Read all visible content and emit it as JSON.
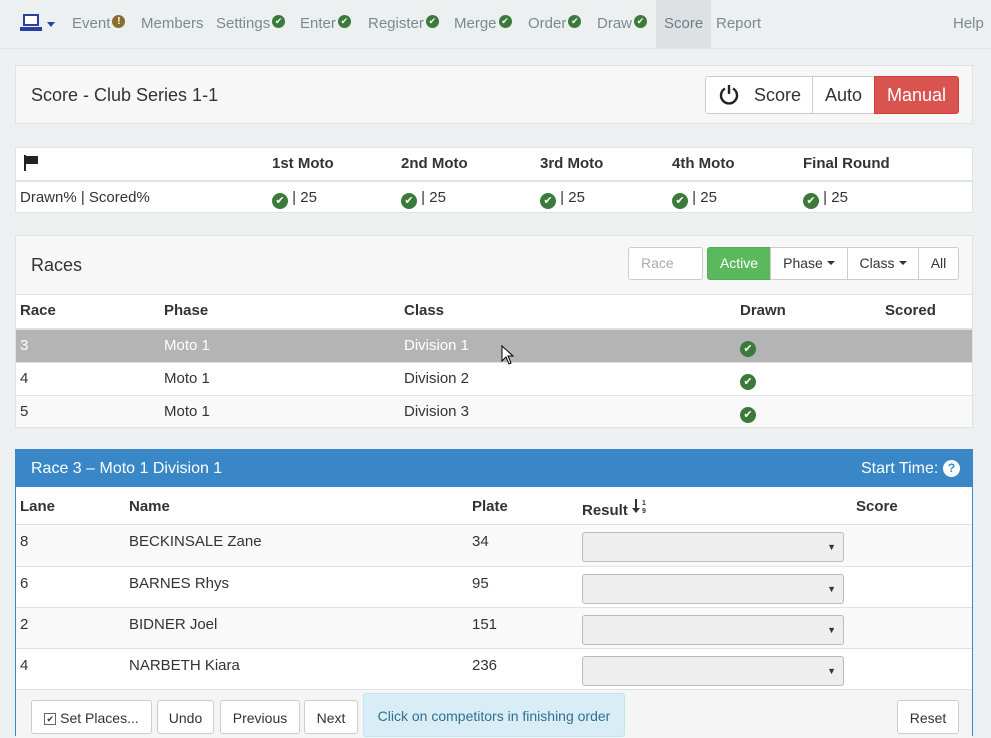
{
  "nav": {
    "items": [
      {
        "label": "Event",
        "status": "warn"
      },
      {
        "label": "Members",
        "status": "none"
      },
      {
        "label": "Settings",
        "status": "ok"
      },
      {
        "label": "Enter",
        "status": "ok"
      },
      {
        "label": "Register",
        "status": "ok"
      },
      {
        "label": "Merge",
        "status": "ok"
      },
      {
        "label": "Order",
        "status": "ok"
      },
      {
        "label": "Draw",
        "status": "ok"
      },
      {
        "label": "Score",
        "status": "active"
      },
      {
        "label": "Report",
        "status": "none"
      }
    ],
    "help": "Help",
    "warn_glyph": "!",
    "ok_glyph": "✔"
  },
  "score_header": {
    "title": "Score - Club Series 1-1",
    "score_label": "Score",
    "auto_label": "Auto",
    "manual_label": "Manual"
  },
  "summary": {
    "columns": [
      "1st Moto",
      "2nd Moto",
      "3rd Moto",
      "4th Moto",
      "Final Round"
    ],
    "row_label": "Drawn% | Scored%",
    "values": [
      "| 25",
      "| 25",
      "| 25",
      "| 25",
      "| 25"
    ]
  },
  "races": {
    "title": "Races",
    "race_placeholder": "Race",
    "active_label": "Active",
    "phase_label": "Phase",
    "class_label": "Class",
    "all_label": "All",
    "headers": {
      "race": "Race",
      "phase": "Phase",
      "class": "Class",
      "drawn": "Drawn",
      "scored": "Scored"
    },
    "rows": [
      {
        "race": "3",
        "phase": "Moto 1",
        "class": "Division 1",
        "drawn": true,
        "scored": ""
      },
      {
        "race": "4",
        "phase": "Moto 1",
        "class": "Division 2",
        "drawn": true,
        "scored": ""
      },
      {
        "race": "5",
        "phase": "Moto 1",
        "class": "Division 3",
        "drawn": true,
        "scored": ""
      }
    ]
  },
  "race_detail": {
    "title": "Race 3 – Moto 1 Division 1",
    "start_time_label": "Start Time:",
    "help_glyph": "?",
    "headers": {
      "lane": "Lane",
      "name": "Name",
      "plate": "Plate",
      "result": "Result",
      "score": "Score"
    },
    "rows": [
      {
        "lane": "8",
        "name": "BECKINSALE Zane",
        "plate": "34",
        "result": "",
        "score": ""
      },
      {
        "lane": "6",
        "name": "BARNES Rhys",
        "plate": "95",
        "result": "",
        "score": ""
      },
      {
        "lane": "2",
        "name": "BIDNER Joel",
        "plate": "151",
        "result": "",
        "score": ""
      },
      {
        "lane": "4",
        "name": "NARBETH Kiara",
        "plate": "236",
        "result": "",
        "score": ""
      }
    ],
    "set_places_label": "Set Places...",
    "undo_label": "Undo",
    "previous_label": "Previous",
    "next_label": "Next",
    "hint": "Click on competitors in finishing order",
    "reset_label": "Reset"
  }
}
